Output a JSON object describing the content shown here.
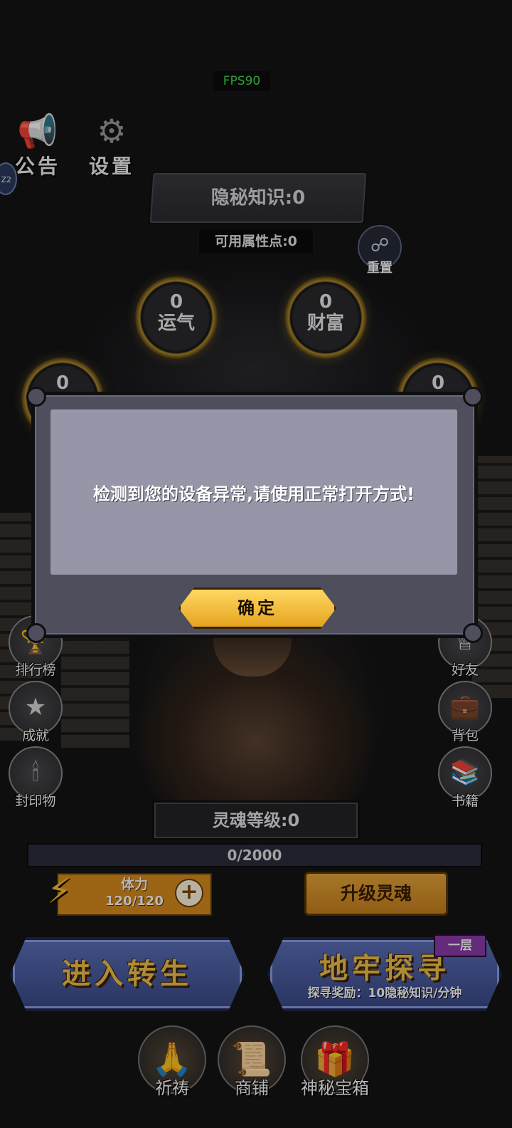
{
  "hud": {
    "fps": "FPS90"
  },
  "top": {
    "notice": {
      "label": "公告",
      "icon": "megaphone-icon"
    },
    "settings": {
      "label": "设置",
      "icon": "gear-icon"
    },
    "badge": "Z2"
  },
  "knowledge": {
    "label": "隐秘知识:0"
  },
  "attr_points": "可用属性点:0",
  "reset": {
    "label": "重置",
    "icon": "link-icon"
  },
  "attributes": [
    {
      "value": "0",
      "name": "运气"
    },
    {
      "value": "0",
      "name": "财富"
    },
    {
      "value": "0",
      "name": ""
    },
    {
      "value": "0",
      "name": ""
    }
  ],
  "left_menu": [
    {
      "label": "排行榜",
      "icon": "trophy-icon"
    },
    {
      "label": "成就",
      "icon": "star-laurel-icon"
    },
    {
      "label": "封印物",
      "icon": "candle-icon"
    }
  ],
  "right_menu": [
    {
      "label": "好友",
      "icon": "friends-icon"
    },
    {
      "label": "背包",
      "icon": "bag-icon"
    },
    {
      "label": "书籍",
      "icon": "books-icon"
    }
  ],
  "soul": {
    "level_label": "灵魂等级:0",
    "exp_text": "0/2000",
    "exp_progress": 0.0
  },
  "stamina": {
    "title": "体力",
    "value": "120/120",
    "plus": "+"
  },
  "upgrade_label": "升级灵魂",
  "rebirth": {
    "label": "进入转生"
  },
  "dungeon": {
    "label": "地牢探寻",
    "reward": "探寻奖励：10隐秘知识/分钟",
    "floor_tag": "一层"
  },
  "bottom_nav": [
    {
      "label": "祈祷",
      "icon": "praying-hands-icon"
    },
    {
      "label": "商铺",
      "icon": "scroll-shop-icon"
    },
    {
      "label": "神秘宝箱",
      "icon": "treasure-chest-icon"
    }
  ],
  "modal": {
    "message": "检测到您的设备异常,请使用正常打开方式!",
    "confirm": "确定"
  },
  "colors": {
    "background": "#141416",
    "modal_frame": "#4e4e5c",
    "modal_panel": "#9696a8",
    "gold": "#e6a320",
    "stamina": "#d98b1e",
    "blue_button": "#4a5ca0",
    "fps_green": "#3ee04a"
  }
}
